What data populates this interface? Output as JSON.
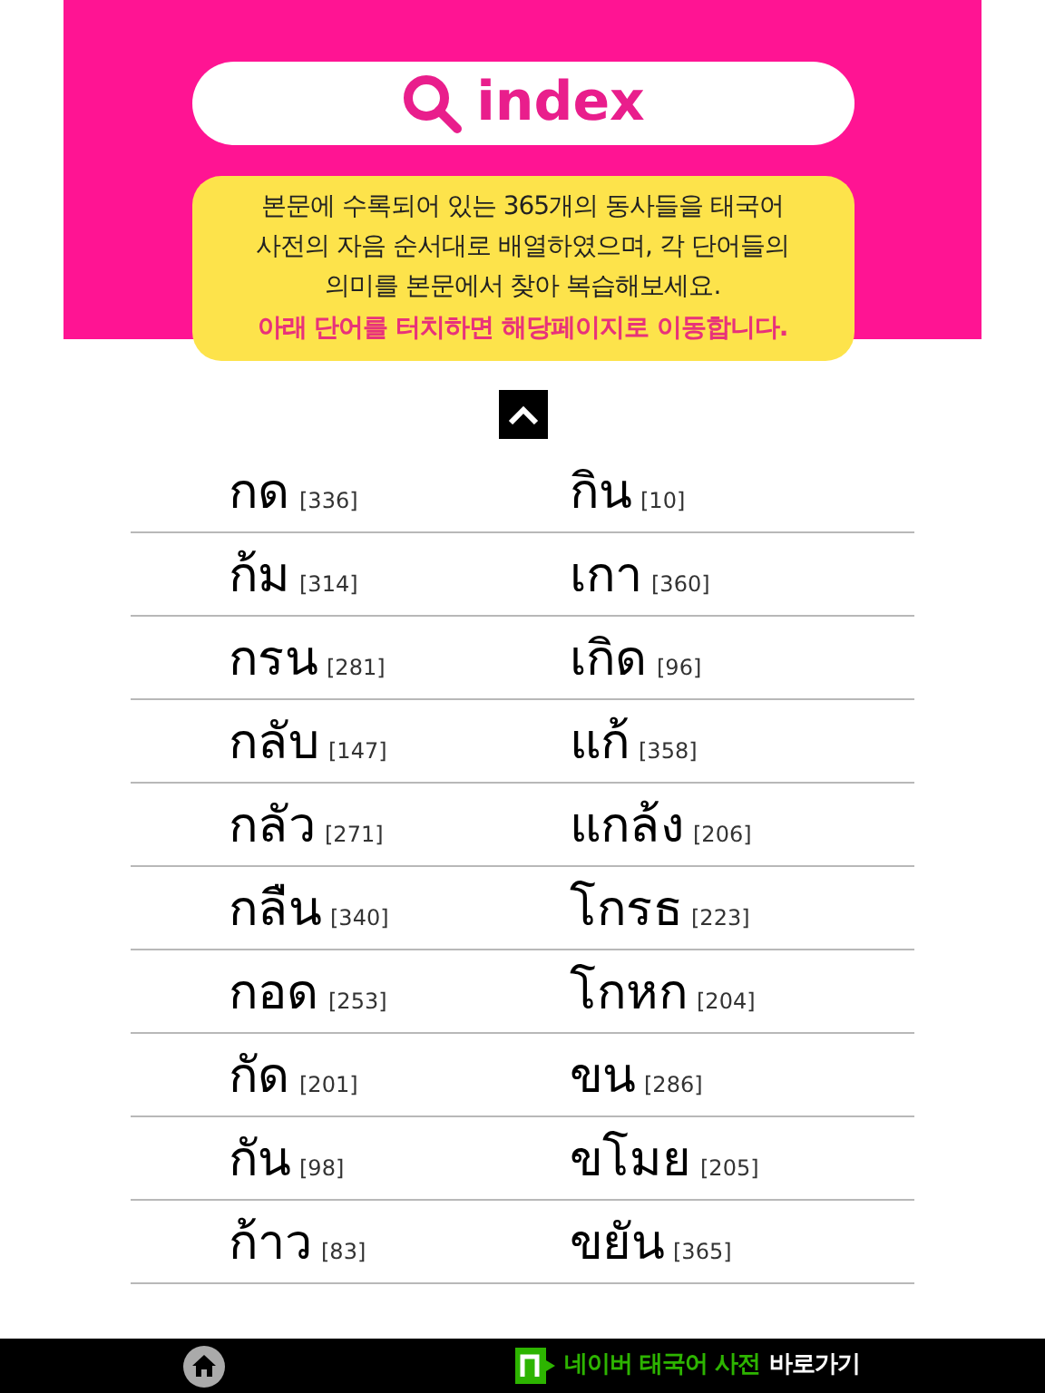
{
  "header": {
    "title": "index"
  },
  "notice": {
    "lines": [
      "본문에 수록되어 있는 365개의 동사들을 태국어",
      "사전의 자음 순서대로 배열하였으며, 각 단어들의",
      "의미를 본문에서 찾아 복습해보세요."
    ],
    "highlight": "아래 단어를 터치하면 해당페이지로 이동합니다."
  },
  "rows": [
    [
      {
        "word": "กด",
        "page": "[336]"
      },
      {
        "word": "กิน",
        "page": "[10]"
      }
    ],
    [
      {
        "word": "ก้ม",
        "page": "[314]"
      },
      {
        "word": "เกา",
        "page": "[360]"
      }
    ],
    [
      {
        "word": "กรน",
        "page": "[281]"
      },
      {
        "word": "เกิด",
        "page": "[96]"
      }
    ],
    [
      {
        "word": "กลับ",
        "page": "[147]"
      },
      {
        "word": "แก้",
        "page": "[358]"
      }
    ],
    [
      {
        "word": "กลัว",
        "page": "[271]"
      },
      {
        "word": "แกล้ง",
        "page": "[206]"
      }
    ],
    [
      {
        "word": "กลืน",
        "page": "[340]"
      },
      {
        "word": "โกรธ",
        "page": "[223]"
      }
    ],
    [
      {
        "word": "กอด",
        "page": "[253]"
      },
      {
        "word": "โกหก",
        "page": "[204]"
      }
    ],
    [
      {
        "word": "กัด",
        "page": "[201]"
      },
      {
        "word": "ขน",
        "page": "[286]"
      }
    ],
    [
      {
        "word": "กัน",
        "page": "[98]"
      },
      {
        "word": "ขโมย",
        "page": "[205]"
      }
    ],
    [
      {
        "word": "ก้าว",
        "page": "[83]"
      },
      {
        "word": "ขยัน",
        "page": "[365]"
      }
    ]
  ],
  "bottom_bar": {
    "link_name": "네이버 태국어 사전",
    "link_action": "바로가기"
  }
}
